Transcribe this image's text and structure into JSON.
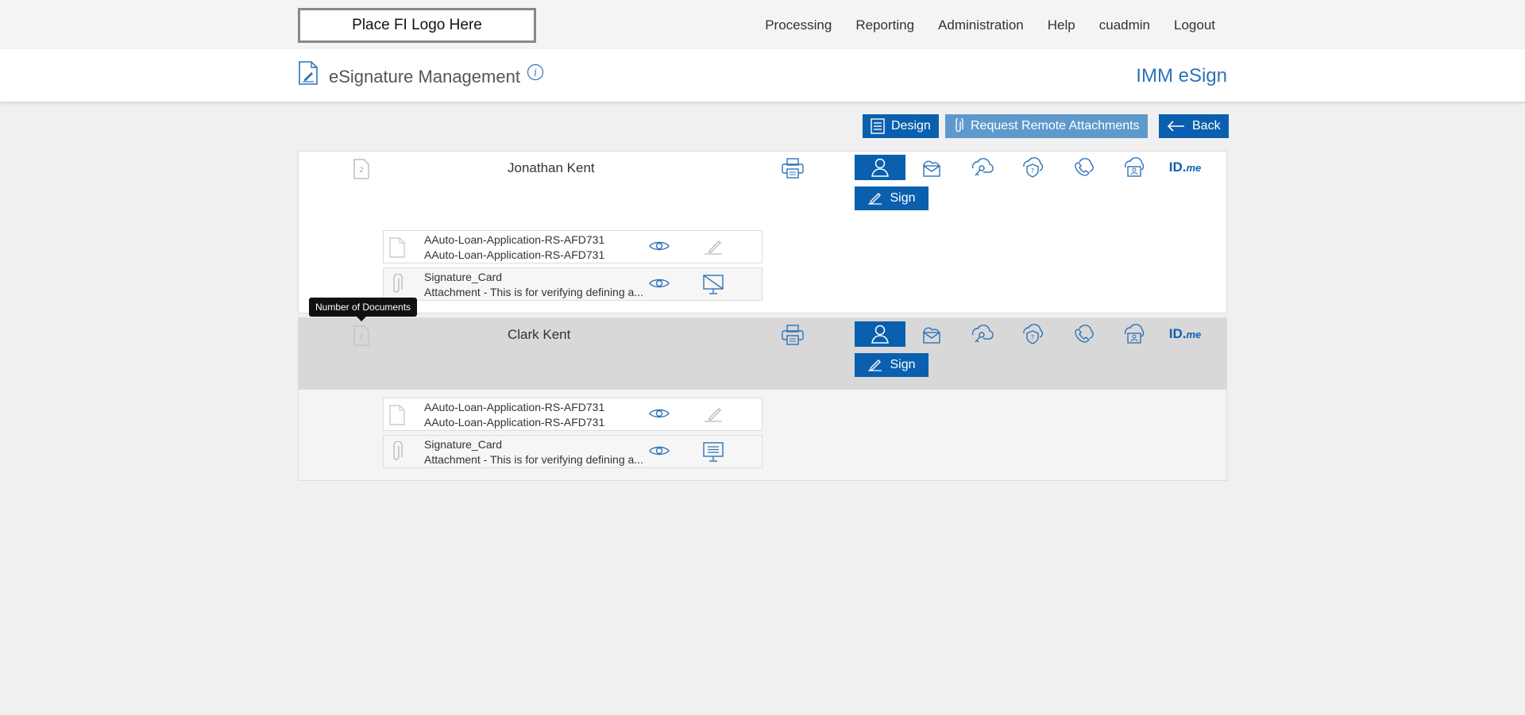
{
  "logo_text": "Place FI Logo Here",
  "nav": [
    "Processing",
    "Reporting",
    "Administration",
    "Help",
    "cuadmin",
    "Logout"
  ],
  "header": {
    "title": "eSignature Management",
    "brand": "IMM eSign"
  },
  "actions": {
    "design": "Design",
    "request": "Request Remote Attachments",
    "back": "Back"
  },
  "tooltip": "Number of Documents",
  "auth_icons": [
    "person-icon",
    "mail-cloud-icon",
    "key-cloud-icon",
    "shield-question-icon",
    "phone-cloud-icon",
    "id-card-cloud-icon",
    "idme-logo"
  ],
  "idme": {
    "main": "ID.",
    "me": "me"
  },
  "colors": {
    "accent": "#0a60ae",
    "accent_light": "#5e99cc",
    "band": "#d8d8d8"
  },
  "signers": [
    {
      "name": "Jonathan Kent",
      "doc_count": "2",
      "sign_label": "Sign",
      "documents": [
        {
          "line1": "AAuto-Loan-Application-RS-AFD731",
          "line2": "AAuto-Loan-Application-RS-AFD731"
        },
        {
          "line1": "Signature_Card",
          "line2": "Attachment - This is for verifying defining a..."
        }
      ]
    },
    {
      "name": "Clark Kent",
      "doc_count": "2",
      "sign_label": "Sign",
      "documents": [
        {
          "line1": "AAuto-Loan-Application-RS-AFD731",
          "line2": "AAuto-Loan-Application-RS-AFD731"
        },
        {
          "line1": "Signature_Card",
          "line2": "Attachment - This is for verifying defining a..."
        }
      ]
    }
  ]
}
